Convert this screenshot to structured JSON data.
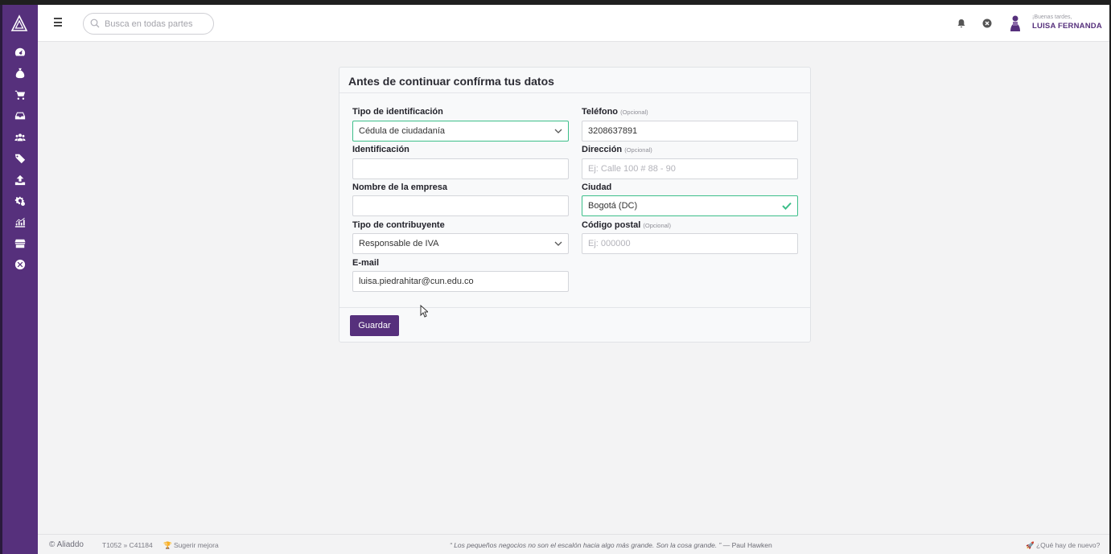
{
  "search": {
    "placeholder": "Busca en todas partes"
  },
  "header": {
    "greeting": "¡Buenas tardes,",
    "user_name": "LUISA FERNANDA"
  },
  "sidebar": {
    "items": [
      {
        "icon": "dashboard-icon"
      },
      {
        "icon": "money-bag-icon"
      },
      {
        "icon": "cart-icon"
      },
      {
        "icon": "inbox-icon"
      },
      {
        "icon": "users-icon"
      },
      {
        "icon": "tags-icon"
      },
      {
        "icon": "upload-icon"
      },
      {
        "icon": "settings-icon"
      },
      {
        "icon": "chart-icon"
      },
      {
        "icon": "store-icon"
      },
      {
        "icon": "close-circle-icon"
      }
    ]
  },
  "form": {
    "title": "Antes de continuar confírma tus datos",
    "id_type": {
      "label": "Tipo de identificación",
      "value": "Cédula de ciudadanía"
    },
    "identification": {
      "label": "Identificación",
      "value": ""
    },
    "company_name": {
      "label": "Nombre de la empresa",
      "value": ""
    },
    "contributor_type": {
      "label": "Tipo de contribuyente",
      "value": "Responsable de IVA"
    },
    "email": {
      "label": "E-mail",
      "value": "luisa.piedrahitar@cun.edu.co"
    },
    "phone": {
      "label": "Teléfono",
      "optional": "(Opcional)",
      "value": "3208637891"
    },
    "address": {
      "label": "Dirección",
      "optional": "(Opcional)",
      "placeholder": "Ej: Calle 100 # 88 - 90"
    },
    "city": {
      "label": "Ciudad",
      "value": "Bogotá (DC)"
    },
    "postal_code": {
      "label": "Código postal",
      "optional": "(Opcional)",
      "placeholder": "Ej: 000000"
    },
    "save_label": "Guardar"
  },
  "footer": {
    "brand": "© Aliaddo",
    "build": "T1052 » C41184",
    "suggest": "🏆 Sugerir mejora",
    "quote": "“ Los pequeños negocios no son el escalón hacia algo más grande. Son la cosa grande. ”",
    "quote_author": "— Paul Hawken",
    "whats_new": "🚀 ¿Qué hay de nuevo?"
  },
  "colors": {
    "brand": "#56307c",
    "valid": "#3dbf8a"
  }
}
